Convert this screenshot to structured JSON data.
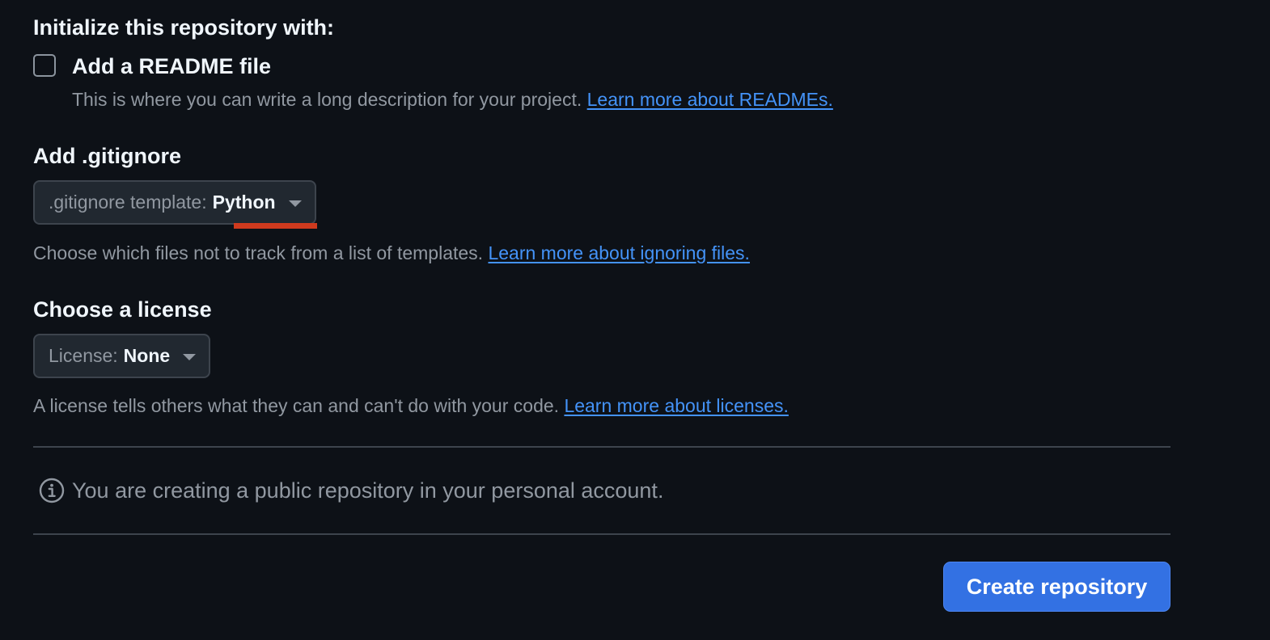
{
  "initialize": {
    "heading": "Initialize this repository with:",
    "readme": {
      "label": "Add a README file",
      "checked": false,
      "description": "This is where you can write a long description for your project.",
      "link_text": "Learn more about READMEs."
    }
  },
  "gitignore": {
    "heading": "Add .gitignore",
    "select_prefix": ".gitignore template:",
    "select_value": "Python",
    "description": "Choose which files not to track from a list of templates.",
    "link_text": "Learn more about ignoring files."
  },
  "license": {
    "heading": "Choose a license",
    "select_prefix": "License:",
    "select_value": "None",
    "description": "A license tells others what they can and can't do with your code.",
    "link_text": "Learn more about licenses."
  },
  "info": {
    "icon": "info-icon",
    "text": "You are creating a public repository in your personal account."
  },
  "actions": {
    "create_label": "Create repository"
  },
  "colors": {
    "background": "#0d1117",
    "text_primary": "#f0f6fc",
    "text_muted": "#9198a1",
    "link": "#4493f8",
    "button_primary": "#3371e3",
    "annotation_underline": "#cf3a1e"
  }
}
